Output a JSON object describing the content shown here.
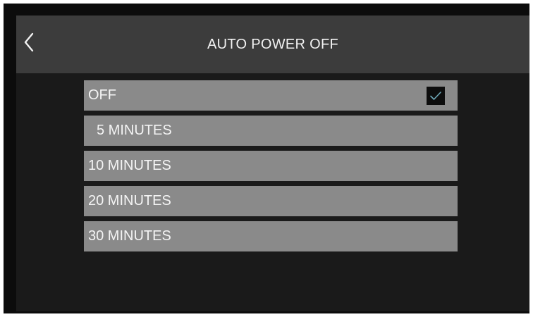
{
  "header": {
    "title": "AUTO POWER OFF",
    "back_icon": "chevron-left-icon"
  },
  "options": [
    {
      "label": "OFF",
      "selected": true
    },
    {
      "label": "5 MINUTES",
      "selected": false
    },
    {
      "label": "10 MINUTES",
      "selected": false
    },
    {
      "label": "20 MINUTES",
      "selected": false
    },
    {
      "label": "30 MINUTES",
      "selected": false
    }
  ],
  "colors": {
    "header_bg": "#3c3c3c",
    "screen_bg": "#1a1a1a",
    "option_bg": "#8a8a8a",
    "check_bg": "#0d0d0d",
    "check_mark": "#6fa8b8"
  }
}
